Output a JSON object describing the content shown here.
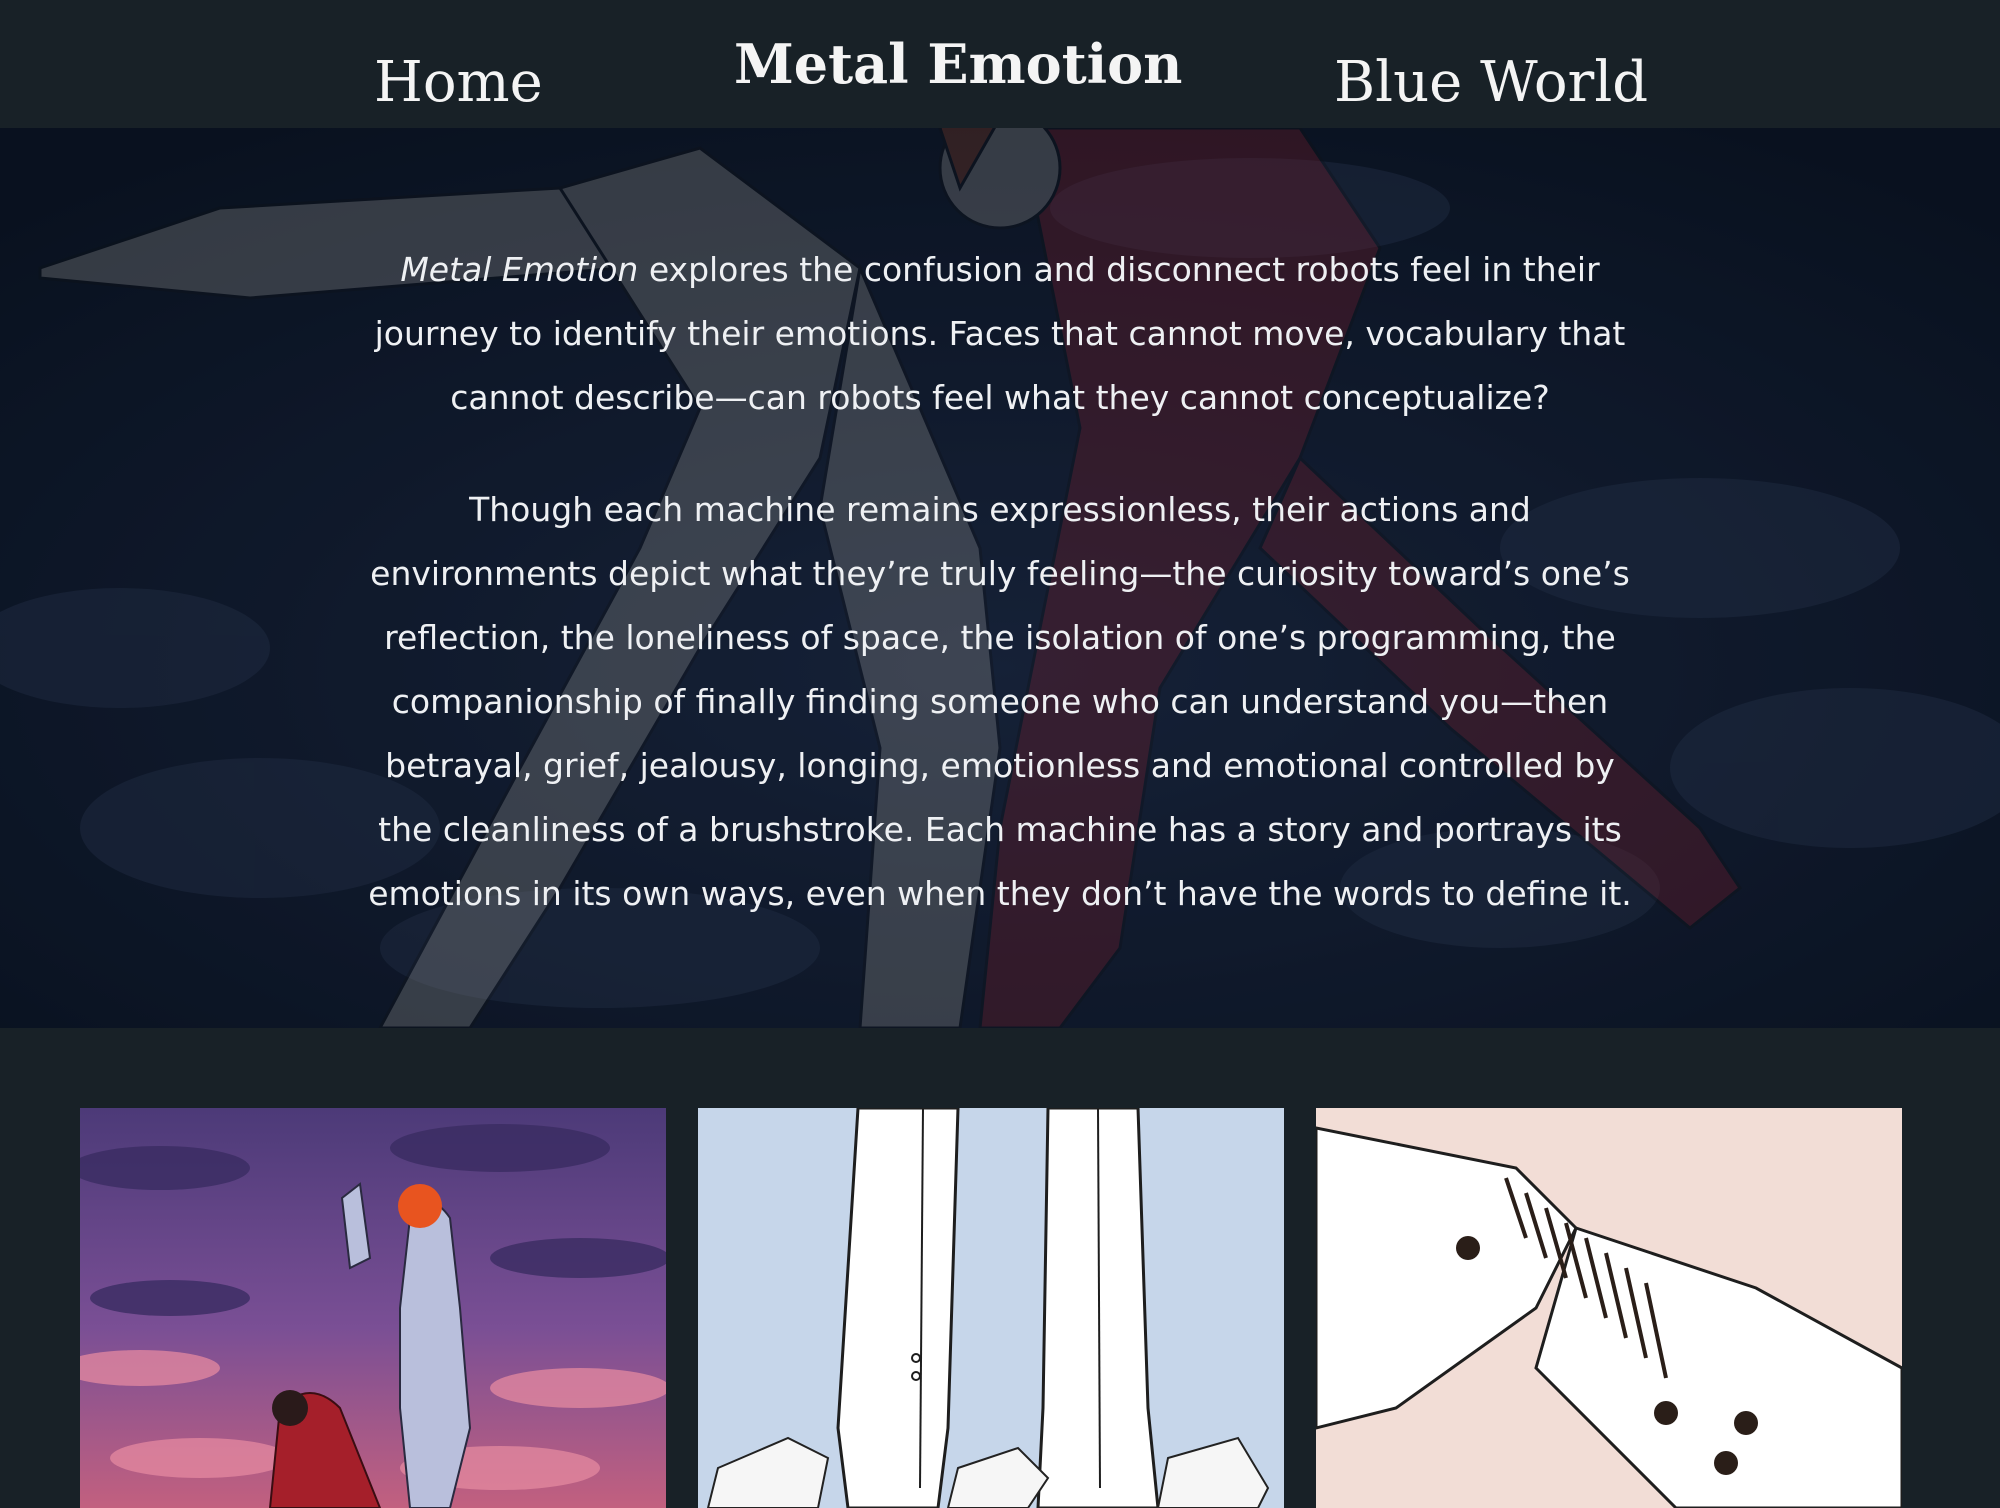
{
  "nav": {
    "home": "Home",
    "current": "Metal Emotion",
    "blue_world": "Blue World"
  },
  "intro": {
    "title_italic": "Metal Emotion",
    "paragraph1_rest": " explores the confusion and disconnect robots feel in their journey to identify their emotions. Faces that cannot move, vocabulary that cannot describe—can robots feel what they cannot conceptualize?",
    "paragraph2": "Though each machine remains expressionless, their actions and environments depict what they’re truly feeling—the curiosity toward’s one’s reflection, the loneliness of space, the isolation of one’s programming, the companionship of finally finding someone who can understand you—then betrayal, grief, jealousy, longing, emotionless and emotional controlled by the cleanliness of a brushstroke. Each machine has a story and portrays its emotions in its own ways, even when they don’t have the words to define it."
  },
  "gallery": {
    "items": [
      {
        "name": "purple-sky-robots-painting"
      },
      {
        "name": "robot-legs-ink-drawing"
      },
      {
        "name": "robot-arm-stitches-drawing"
      }
    ]
  },
  "colors": {
    "nav_background": "#182127",
    "hero_overlay": "#0c1522",
    "text": "#eef0f3",
    "accent_red": "#b8242e",
    "sky_purple": "#6b4f8f"
  }
}
